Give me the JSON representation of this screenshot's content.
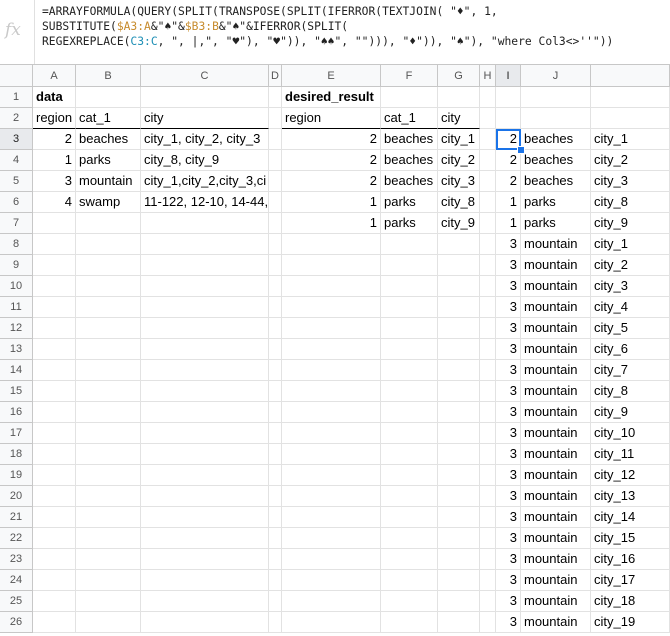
{
  "formula_bar": {
    "fx_label": "fx",
    "formula_text": "=ARRAYFORMULA(QUERY(SPLIT(TRANSPOSE(SPLIT(IFERROR(TEXTJOIN( \"♦\", 1,\nSUBSTITUTE($A3:A&\"♠\"&$B3:B&\"♠\"&IFERROR(SPLIT(\nREGEXREPLACE(C3:C, \", |,\", \"♥\"), \"♥\")), \"♠♠\", \"\"))), \"♦\")), \"♠\"), \"where Col3<>''\"))",
    "ref_colors": {
      "range_a": "#c78b2c",
      "range_c": "#1e8fb5"
    }
  },
  "columns": [
    "A",
    "B",
    "C",
    "D",
    "E",
    "F",
    "G",
    "H",
    "I",
    "J"
  ],
  "rows": [
    "1",
    "2",
    "3",
    "4",
    "5",
    "6",
    "7",
    "8",
    "9",
    "10",
    "11",
    "12",
    "13",
    "14",
    "15",
    "16",
    "17",
    "18",
    "19",
    "20",
    "21",
    "22",
    "23",
    "24",
    "25",
    "26"
  ],
  "selected": {
    "col": "I",
    "row": "3"
  },
  "source_table": {
    "title": "data",
    "headers": [
      "region",
      "cat_1",
      "city"
    ],
    "rows": [
      [
        "2",
        "beaches",
        "city_1, city_2, city_3"
      ],
      [
        "1",
        "parks",
        "city_8, city_9"
      ],
      [
        "3",
        "mountain",
        "city_1,city_2,city_3,ci"
      ],
      [
        "4",
        "swamp",
        "11-122, 12-10, 14-44,"
      ]
    ]
  },
  "desired_table": {
    "title": "desired_result",
    "headers": [
      "region",
      "cat_1",
      "city"
    ],
    "rows": [
      [
        "2",
        "beaches",
        "city_1"
      ],
      [
        "2",
        "beaches",
        "city_2"
      ],
      [
        "2",
        "beaches",
        "city_3"
      ],
      [
        "1",
        "parks",
        "city_8"
      ],
      [
        "1",
        "parks",
        "city_9"
      ]
    ]
  },
  "result_table": {
    "rows": [
      [
        "2",
        "beaches",
        "city_1"
      ],
      [
        "2",
        "beaches",
        "city_2"
      ],
      [
        "2",
        "beaches",
        "city_3"
      ],
      [
        "1",
        "parks",
        "city_8"
      ],
      [
        "1",
        "parks",
        "city_9"
      ],
      [
        "3",
        "mountain",
        "city_1"
      ],
      [
        "3",
        "mountain",
        "city_2"
      ],
      [
        "3",
        "mountain",
        "city_3"
      ],
      [
        "3",
        "mountain",
        "city_4"
      ],
      [
        "3",
        "mountain",
        "city_5"
      ],
      [
        "3",
        "mountain",
        "city_6"
      ],
      [
        "3",
        "mountain",
        "city_7"
      ],
      [
        "3",
        "mountain",
        "city_8"
      ],
      [
        "3",
        "mountain",
        "city_9"
      ],
      [
        "3",
        "mountain",
        "city_10"
      ],
      [
        "3",
        "mountain",
        "city_11"
      ],
      [
        "3",
        "mountain",
        "city_12"
      ],
      [
        "3",
        "mountain",
        "city_13"
      ],
      [
        "3",
        "mountain",
        "city_14"
      ],
      [
        "3",
        "mountain",
        "city_15"
      ],
      [
        "3",
        "mountain",
        "city_16"
      ],
      [
        "3",
        "mountain",
        "city_17"
      ],
      [
        "3",
        "mountain",
        "city_18"
      ],
      [
        "3",
        "mountain",
        "city_19"
      ]
    ]
  }
}
